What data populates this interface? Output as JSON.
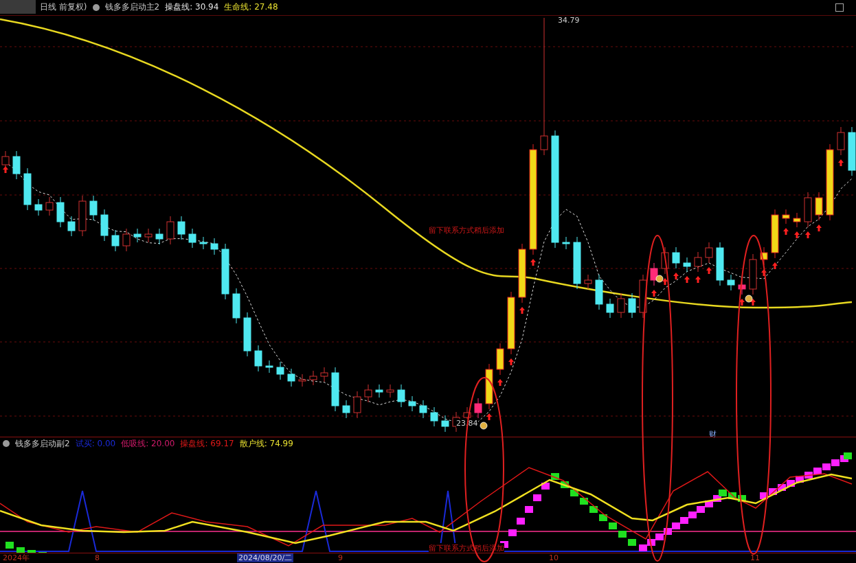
{
  "main_panel": {
    "period_label": "日线 前复权)",
    "indicator_name": "钱多多启动主2",
    "readouts": [
      {
        "label": "操盘线: 30.94",
        "color": "#e6e6e6"
      },
      {
        "label": "生命线: 27.48",
        "color": "#e8e030"
      }
    ],
    "high_label": "34.79",
    "low_label": "23.84",
    "note": "留下联系方式稍后添加",
    "marker": "财"
  },
  "sub_panel": {
    "indicator_name": "钱多多启动副2",
    "readouts": [
      {
        "label": "试买: 0.00",
        "color": "#1a2ad8"
      },
      {
        "label": "低吸线: 20.00",
        "color": "#d01a6a"
      },
      {
        "label": "操盘线: 69.17",
        "color": "#e01818"
      },
      {
        "label": "散户线: 74.99",
        "color": "#e8e030"
      }
    ],
    "note": "留下联系方式稍后添加"
  },
  "time_axis": [
    {
      "label": "2024年",
      "selected": false
    },
    {
      "label": "8",
      "selected": false
    },
    {
      "label": "2024/08/20/二",
      "selected": true
    },
    {
      "label": "9",
      "selected": false
    },
    {
      "label": "10",
      "selected": false
    },
    {
      "label": "11",
      "selected": false
    }
  ]
}
